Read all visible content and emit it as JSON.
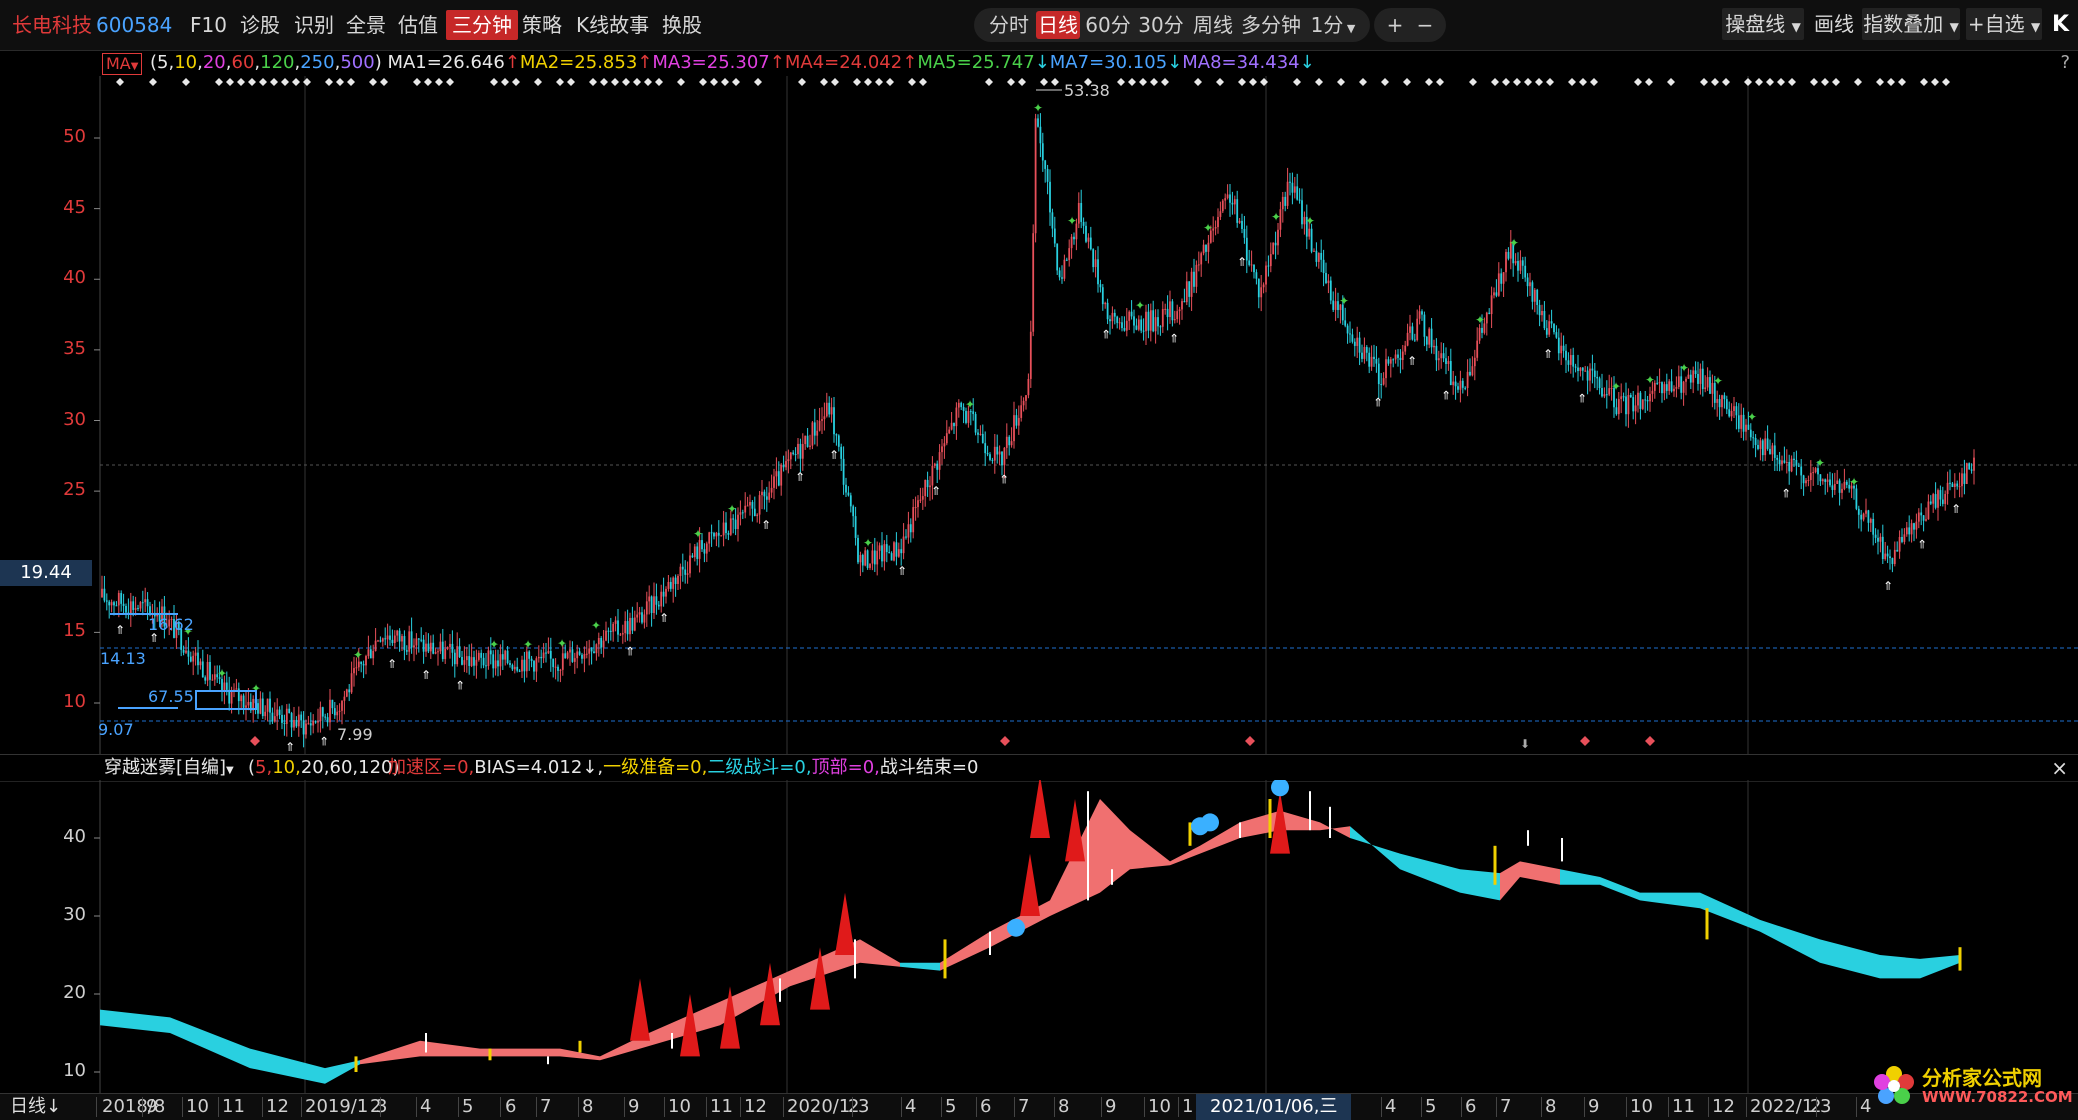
{
  "stock": {
    "name": "长电科技",
    "code": "600584"
  },
  "nav": [
    "F10",
    "诊股",
    "识别",
    "全景",
    "估值",
    "三分钟",
    "策略",
    "K线故事",
    "换股"
  ],
  "nav_active": "三分钟",
  "periods": [
    "分时",
    "日线",
    "60分",
    "30分",
    "周线",
    "多分钟",
    "1分"
  ],
  "period_active": "日线",
  "zoom_buttons": [
    "+",
    "−"
  ],
  "right_tools": [
    "操盘线",
    "画线",
    "指数叠加",
    "+自选"
  ],
  "right_icon": "K",
  "ma": {
    "button": "MA",
    "params_open": "(",
    "params": [
      {
        "v": "5",
        "c": "#e8e8e8"
      },
      {
        "v": "10",
        "c": "#f0d000"
      },
      {
        "v": "20",
        "c": "#e040e0"
      },
      {
        "v": "60",
        "c": "#e03a3a"
      },
      {
        "v": "120",
        "c": "#4ad04a"
      },
      {
        "v": "250",
        "c": "#4aa3ff"
      },
      {
        "v": "500",
        "c": "#a070ff"
      }
    ],
    "params_close": ")",
    "values": [
      {
        "label": "MA1=26.646",
        "arrow": "↑",
        "c": "#e8e8e8",
        "ac": "#e03a3a"
      },
      {
        "label": "MA2=25.853",
        "arrow": "↑",
        "c": "#f0d000",
        "ac": "#e03a3a"
      },
      {
        "label": "MA3=25.307",
        "arrow": "↑",
        "c": "#e040e0",
        "ac": "#e03a3a"
      },
      {
        "label": "MA4=24.042",
        "arrow": "↑",
        "c": "#e03a3a",
        "ac": "#e03a3a"
      },
      {
        "label": "MA5=25.747",
        "arrow": "↓",
        "c": "#4ad04a",
        "ac": "#29d0e0"
      },
      {
        "label": "MA7=30.105",
        "arrow": "↓",
        "c": "#4aa3ff",
        "ac": "#29d0e0"
      },
      {
        "label": "MA8=34.434",
        "arrow": "↓",
        "c": "#a070ff",
        "ac": "#29d0e0"
      }
    ]
  },
  "price_axis": {
    "ticks": [
      "50",
      "45",
      "40",
      "35",
      "30",
      "25",
      "15",
      "10"
    ],
    "crosshair_value": "19.44"
  },
  "annotations": {
    "high": "53.38",
    "low": "7.99",
    "low_line": "9.07",
    "level1": "14.13",
    "level2": "16.62",
    "level3": "67.55"
  },
  "indicator": {
    "name": "穿越迷雾[自编]",
    "params": "(5,10,20,60,120)",
    "items": [
      {
        "label": "加速区=0",
        "c": "#e03a3a"
      },
      {
        "label": "BIAS=4.012↓",
        "c": "#e8e8e8"
      },
      {
        "label": "一级准备=0",
        "c": "#f0d000"
      },
      {
        "label": "二级战斗=0",
        "c": "#29d0e0"
      },
      {
        "label": "顶部=0",
        "c": "#e040e0"
      },
      {
        "label": "战斗结束=0",
        "c": "#e8e8e8"
      }
    ],
    "axis": [
      "40",
      "30",
      "20",
      "10"
    ],
    "close": "×"
  },
  "date_axis": {
    "period_label": "日线",
    "labels": [
      "2018/8",
      "9",
      "10",
      "11",
      "12",
      "2019/1",
      "2",
      "3",
      "4",
      "5",
      "6",
      "7",
      "8",
      "9",
      "10",
      "11",
      "12",
      "2020/1",
      "2",
      "3",
      "4",
      "5",
      "6",
      "7",
      "8",
      "9",
      "10",
      "1",
      "2021/01/06,三",
      "4",
      "5",
      "6",
      "7",
      "8",
      "9",
      "10",
      "11",
      "12",
      "2022/1",
      "2",
      "3",
      "4"
    ]
  },
  "watermark": {
    "title": "分析家公式网",
    "url": "WWW.70822.COM"
  },
  "colors": {
    "up": "#e8505a",
    "down": "#29d0e0",
    "accent": "#c62828",
    "grid": "#1f3a5a"
  }
}
